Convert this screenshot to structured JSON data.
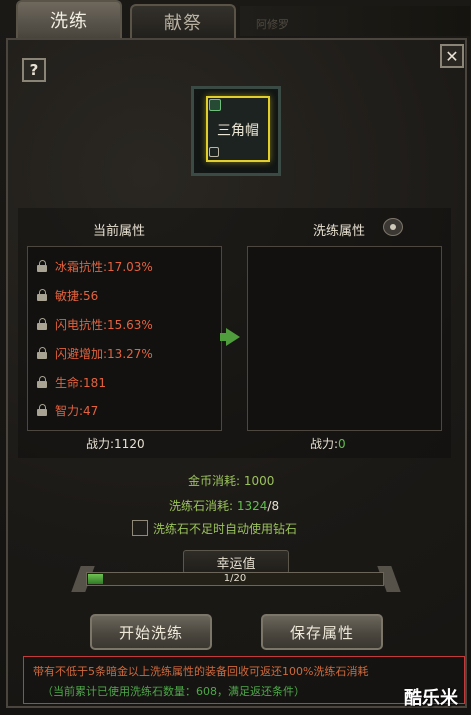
{
  "tabs": [
    {
      "label": "洗练",
      "active": true
    },
    {
      "label": "献祭",
      "active": false
    }
  ],
  "top_faded_label": "阿修罗",
  "buttons": {
    "help": "?",
    "close": "✕",
    "start": "开始洗练",
    "save": "保存属性"
  },
  "item": {
    "name": "三角帽"
  },
  "current": {
    "header": "当前属性",
    "attributes": [
      "冰霜抗性:17.03%",
      "敏捷:56",
      "闪电抗性:15.63%",
      "闪避增加:13.27%",
      "生命:181",
      "智力:47"
    ],
    "power_label": "战力:",
    "power_value": "1120"
  },
  "refined": {
    "header": "洗练属性",
    "power_label": "战力:",
    "power_value": "0"
  },
  "costs": {
    "gold_label": "金币消耗:",
    "gold_value": "1000",
    "stone_label": "洗练石消耗:",
    "stone_have": "1324",
    "stone_need": "/8"
  },
  "auto_use_label": "洗练石不足时自动使用钻石",
  "luck": {
    "title": "幸运值",
    "text": "1/20",
    "fraction": 0.05
  },
  "notice": {
    "line1": "带有不低于5条暗金以上洗练属性的装备回收可返还100%洗练石消耗",
    "line2": "（当前累计已使用洗练石数量：608，满足返还条件）"
  },
  "watermark": "酷乐米",
  "colors": {
    "attribute": "#e2633f",
    "positive": "#5ec14a",
    "notice_border": "#c23a3a",
    "slot_highlight": "#e2cf2a"
  }
}
